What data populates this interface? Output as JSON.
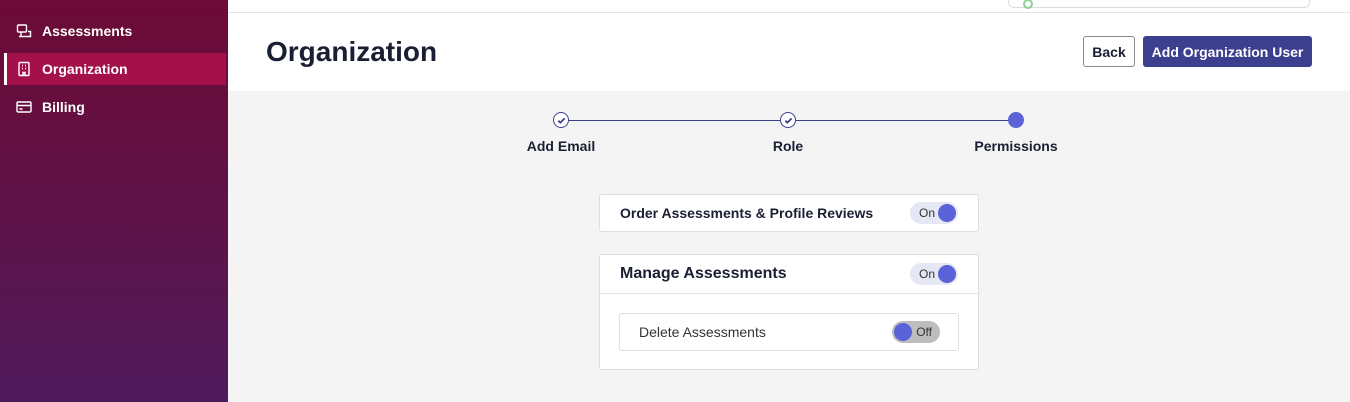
{
  "sidebar": {
    "items": [
      {
        "label": "Assessments",
        "icon": "assessments-icon",
        "active": false
      },
      {
        "label": "Organization",
        "icon": "building-icon",
        "active": true
      },
      {
        "label": "Billing",
        "icon": "credit-card-icon",
        "active": false
      }
    ]
  },
  "header": {
    "title": "Organization",
    "back_label": "Back",
    "add_user_label": "Add Organization User"
  },
  "stepper": {
    "steps": [
      {
        "label": "Add Email",
        "state": "complete"
      },
      {
        "label": "Role",
        "state": "complete"
      },
      {
        "label": "Permissions",
        "state": "current"
      }
    ]
  },
  "permissions": {
    "order": {
      "label": "Order Assessments & Profile Reviews",
      "toggle": "On"
    },
    "manage": {
      "label": "Manage Assessments",
      "toggle": "On",
      "delete": {
        "label": "Delete Assessments",
        "toggle": "Off"
      }
    }
  },
  "colors": {
    "sidebar_top": "#6d0a35",
    "sidebar_bottom": "#4f1a5c",
    "sidebar_active": "#a3104a",
    "primary": "#3c3f8e",
    "toggle_knob": "#5b63d8"
  }
}
